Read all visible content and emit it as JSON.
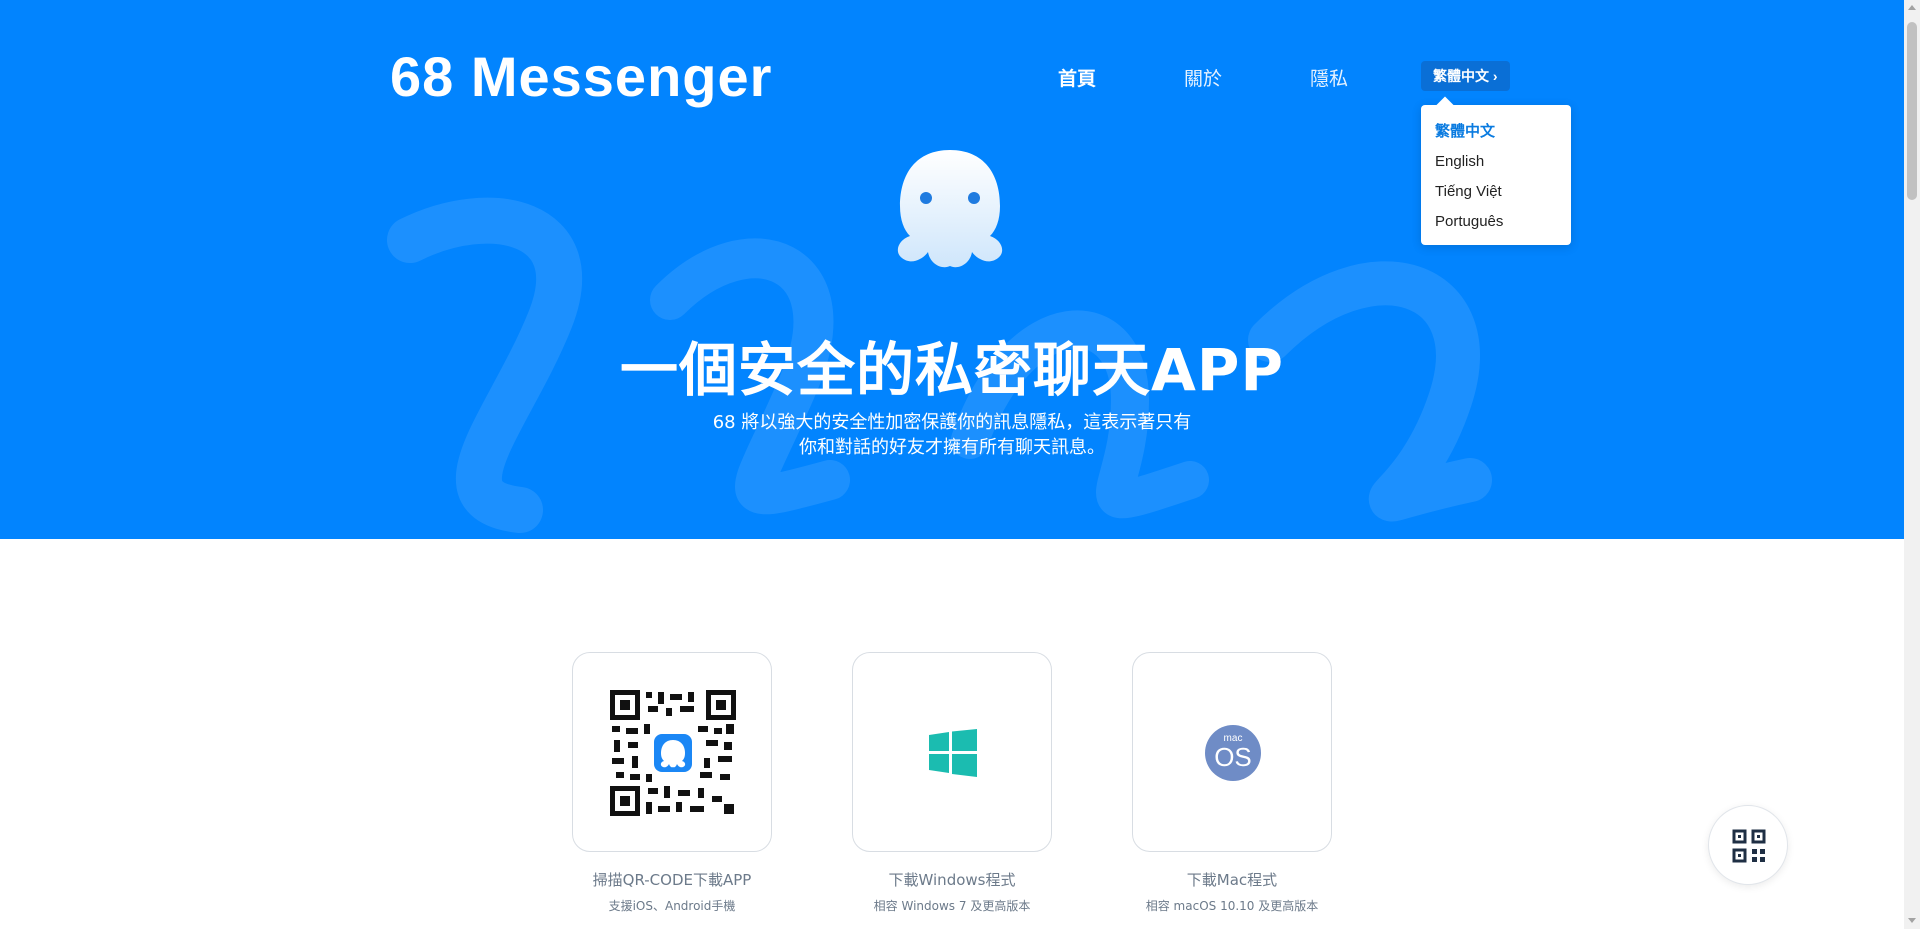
{
  "brand": {
    "logo_text": "68 Messenger"
  },
  "nav": {
    "items": [
      {
        "label": "首頁",
        "active": true
      },
      {
        "label": "關於",
        "active": false
      },
      {
        "label": "隱私",
        "active": false
      }
    ]
  },
  "language": {
    "current": "繁體中文",
    "chevron": "›",
    "options": [
      "繁體中文",
      "English",
      "Tiếng Việt",
      "Português"
    ]
  },
  "hero": {
    "headline": "一個安全的私密聊天APP",
    "subtitle_line1": "68 將以強大的安全性加密保護你的訊息隱私，這表示著只有",
    "subtitle_line2": "你和對話的好友才擁有所有聊天訊息。"
  },
  "downloads": [
    {
      "icon": "qr-code-icon",
      "title": "掃描QR-CODE下載APP",
      "subtitle": "支援iOS、Android手機"
    },
    {
      "icon": "windows-icon",
      "title": "下載Windows程式",
      "subtitle": "相容 Windows 7 及更高版本"
    },
    {
      "icon": "macos-icon",
      "title": "下載Mac程式",
      "subtitle": "相容 macOS 10.10 及更高版本",
      "badge_small": "mac",
      "badge_large": "OS"
    }
  ],
  "colors": {
    "hero_blue": "#0284fe",
    "windows_teal": "#1bbcb0",
    "mac_badge": "#6f8cc6",
    "muted_text": "#6c7a8a"
  }
}
